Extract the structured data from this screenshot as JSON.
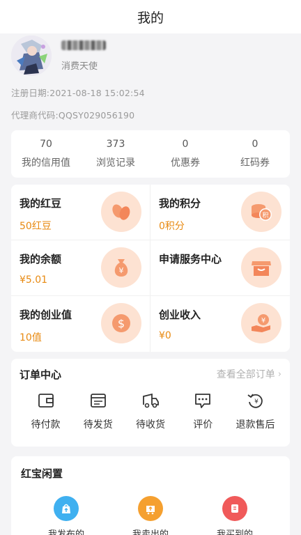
{
  "header": {
    "title": "我的"
  },
  "profile": {
    "role": "消费天使",
    "register_date": "注册日期:2021-08-18 15:02:54",
    "agent_code": "代理商代码:QQSY029056190"
  },
  "stats": [
    {
      "value": "70",
      "label": "我的信用值"
    },
    {
      "value": "373",
      "label": "浏览记录"
    },
    {
      "value": "0",
      "label": "优惠券"
    },
    {
      "value": "0",
      "label": "红码券"
    }
  ],
  "assets": [
    {
      "title": "我的红豆",
      "value": "50红豆",
      "icon": "beans-icon"
    },
    {
      "title": "我的积分",
      "value": "0积分",
      "icon": "points-coins-icon"
    },
    {
      "title": "我的余额",
      "value": "¥5.01",
      "icon": "money-bag-icon"
    },
    {
      "title": "申请服务中心",
      "value": "",
      "icon": "store-icon"
    },
    {
      "title": "我的创业值",
      "value": "10值",
      "icon": "dollar-coin-icon"
    },
    {
      "title": "创业收入",
      "value": "¥0",
      "icon": "income-hand-icon"
    }
  ],
  "orders": {
    "title": "订单中心",
    "view_all": "查看全部订单",
    "items": [
      {
        "label": "待付款",
        "icon": "wallet-icon"
      },
      {
        "label": "待发货",
        "icon": "package-icon"
      },
      {
        "label": "待收货",
        "icon": "truck-icon"
      },
      {
        "label": "评价",
        "icon": "comment-icon"
      },
      {
        "label": "退款售后",
        "icon": "refund-icon"
      }
    ]
  },
  "secondhand": {
    "title": "红宝闲置",
    "items": [
      {
        "label": "我发布的",
        "icon": "publish-bag-icon",
        "color": "#3fb0f0"
      },
      {
        "label": "我卖出的",
        "icon": "sold-cart-icon",
        "color": "#f5a030"
      },
      {
        "label": "我买到的",
        "icon": "bought-icon",
        "color": "#f05a5a"
      }
    ]
  },
  "colors": {
    "accent": "#e88a12",
    "icon_bg": "#fde2d2",
    "icon_fg": "#f59a6e"
  }
}
